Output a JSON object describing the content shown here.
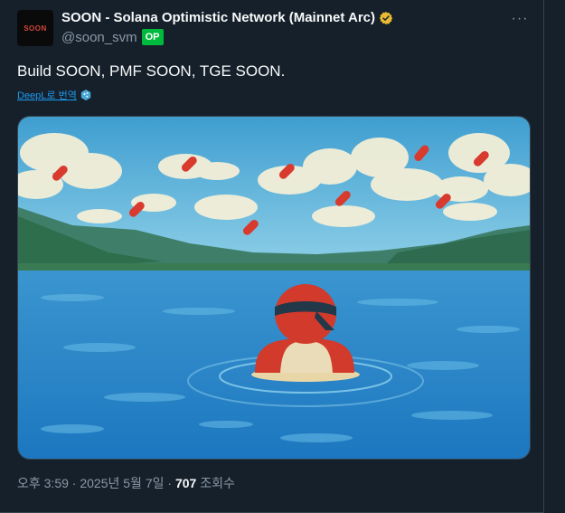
{
  "author": {
    "display_name": "SOON - Solana Optimistic Network (Mainnet Arc)",
    "handle": "@soon_svm",
    "badge": "OP",
    "avatar_text": "SOON",
    "verified": true
  },
  "tweet": {
    "text": "Build SOON, PMF SOON, TGE SOON.",
    "translate_label": "DeepL로 번역"
  },
  "meta": {
    "time": "오후 3:59",
    "date": "2025년 5월 7일",
    "views": "707",
    "views_label": "조회수"
  },
  "colors": {
    "background": "#15202b",
    "accent": "#1d9bf0",
    "badge": "#00ba3d",
    "verified": "#e8b931"
  },
  "icons": {
    "more": "more-horizontal-icon",
    "verified": "verified-badge-icon",
    "deepl": "deepl-icon"
  }
}
